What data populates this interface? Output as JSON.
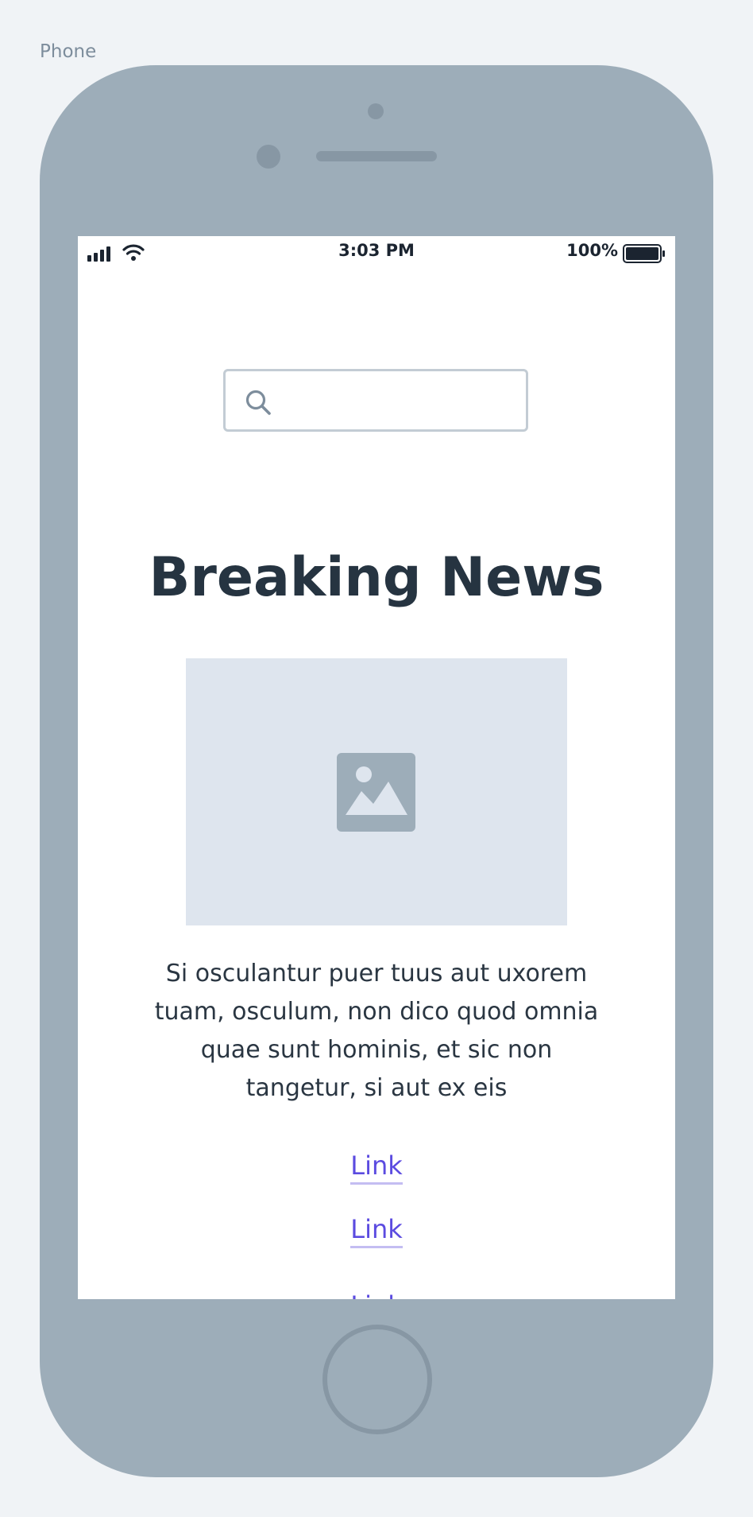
{
  "frame": {
    "label": "Phone"
  },
  "status_bar": {
    "time": "3:03 PM",
    "battery_percent": "100%",
    "icons": [
      "signal-icon",
      "wifi-icon",
      "battery-icon"
    ]
  },
  "search": {
    "value": "",
    "placeholder": "",
    "icon": "search-icon"
  },
  "article": {
    "title": "Breaking News",
    "image_icon": "image-icon",
    "body": "Si osculantur puer tuus aut uxorem tuam, osculum, non dico quod omnia quae sunt hominis, et sic non tangetur, si aut ex eis"
  },
  "links": [
    {
      "label": "Link"
    },
    {
      "label": "Link"
    },
    {
      "label": "Link"
    }
  ],
  "colors": {
    "background": "#f0f3f6",
    "phone_body": "#9dadb9",
    "headline": "#263441",
    "link": "#5b4be0",
    "image_placeholder": "#dee5ee"
  }
}
